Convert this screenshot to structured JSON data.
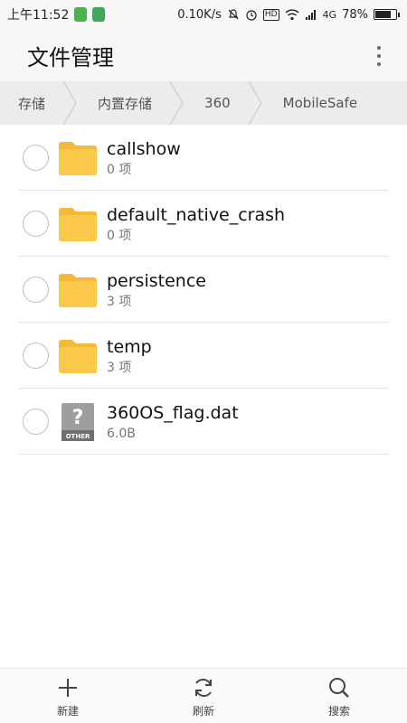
{
  "status_bar": {
    "time": "上午11:52",
    "net_speed": "0.10K/s",
    "hd": "HD",
    "network": "4G",
    "battery": "78%",
    "battery_level": 0.78
  },
  "app_bar": {
    "title": "文件管理",
    "more_icon": "more-vert-icon"
  },
  "breadcrumb": [
    "存储",
    "内置存储",
    "360",
    "MobileSafe"
  ],
  "files": [
    {
      "name": "callshow",
      "meta": "0 项",
      "type": "folder"
    },
    {
      "name": "default_native_crash",
      "meta": "0 项",
      "type": "folder"
    },
    {
      "name": "persistence",
      "meta": "3 项",
      "type": "folder"
    },
    {
      "name": "temp",
      "meta": "3 项",
      "type": "folder"
    },
    {
      "name": "360OS_flag.dat",
      "meta": "6.0B",
      "type": "other",
      "icon_label": "OTHER"
    }
  ],
  "bottom_bar": {
    "new": "新建",
    "refresh": "刷新",
    "search": "搜索"
  },
  "colors": {
    "folder": "#fcc84a",
    "folder_tab": "#f5b93a",
    "breadcrumb_bg": "#ececec",
    "divider": "#e4e4e4"
  }
}
